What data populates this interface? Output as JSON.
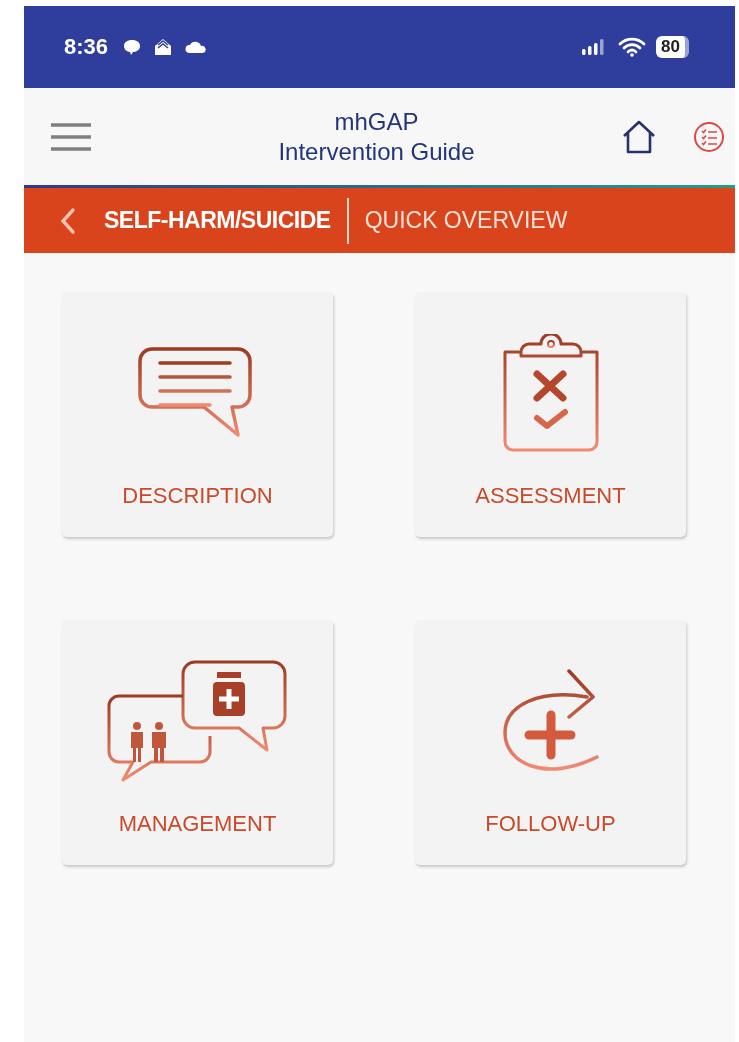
{
  "status_bar": {
    "time": "8:36",
    "battery": "80"
  },
  "header": {
    "title": "mhGAP",
    "subtitle": "Intervention Guide"
  },
  "breadcrumb": {
    "section": "SELF-HARM/SUICIDE",
    "page": "QUICK OVERVIEW"
  },
  "tiles": [
    {
      "label": "DESCRIPTION",
      "kind": "speech"
    },
    {
      "label": "ASSESSMENT",
      "kind": "clipboard"
    },
    {
      "label": "MANAGEMENT",
      "kind": "consult"
    },
    {
      "label": "FOLLOW-UP",
      "kind": "followup"
    }
  ]
}
